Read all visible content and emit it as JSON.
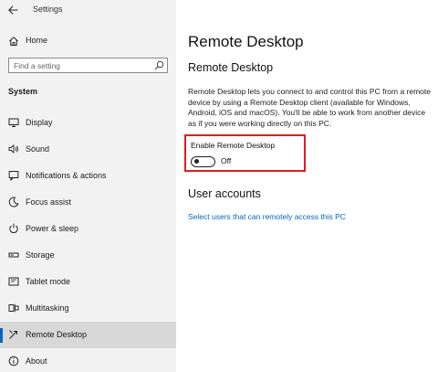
{
  "window": {
    "title": "Settings"
  },
  "sidebar": {
    "home_label": "Home",
    "search_placeholder": "Find a setting",
    "section_label": "System",
    "items": [
      {
        "label": "Display",
        "icon": "display-icon"
      },
      {
        "label": "Sound",
        "icon": "speaker-icon"
      },
      {
        "label": "Notifications & actions",
        "icon": "notification-icon"
      },
      {
        "label": "Focus assist",
        "icon": "moon-icon"
      },
      {
        "label": "Power & sleep",
        "icon": "power-icon"
      },
      {
        "label": "Storage",
        "icon": "storage-icon"
      },
      {
        "label": "Tablet mode",
        "icon": "tablet-icon"
      },
      {
        "label": "Multitasking",
        "icon": "multitasking-icon"
      },
      {
        "label": "Remote Desktop",
        "icon": "remote-desktop-icon",
        "selected": true
      },
      {
        "label": "About",
        "icon": "info-icon"
      }
    ]
  },
  "main": {
    "page_title": "Remote Desktop",
    "section_heading": "Remote Desktop",
    "description": "Remote Desktop lets you connect to and control this PC from a remote device by using a Remote Desktop client (available for Windows, Android, iOS and macOS). You'll be able to work from another device as if you were working directly on this PC.",
    "toggle": {
      "label": "Enable Remote Desktop",
      "state": "Off",
      "on": false
    },
    "user_accounts_heading": "User accounts",
    "user_accounts_link": "Select users that can remotely access this PC"
  },
  "colors": {
    "accent": "#0067c0",
    "highlight_border": "#e21b23",
    "sidebar_bg": "#f2f2f2",
    "selected_bg": "#d8d8d8"
  }
}
